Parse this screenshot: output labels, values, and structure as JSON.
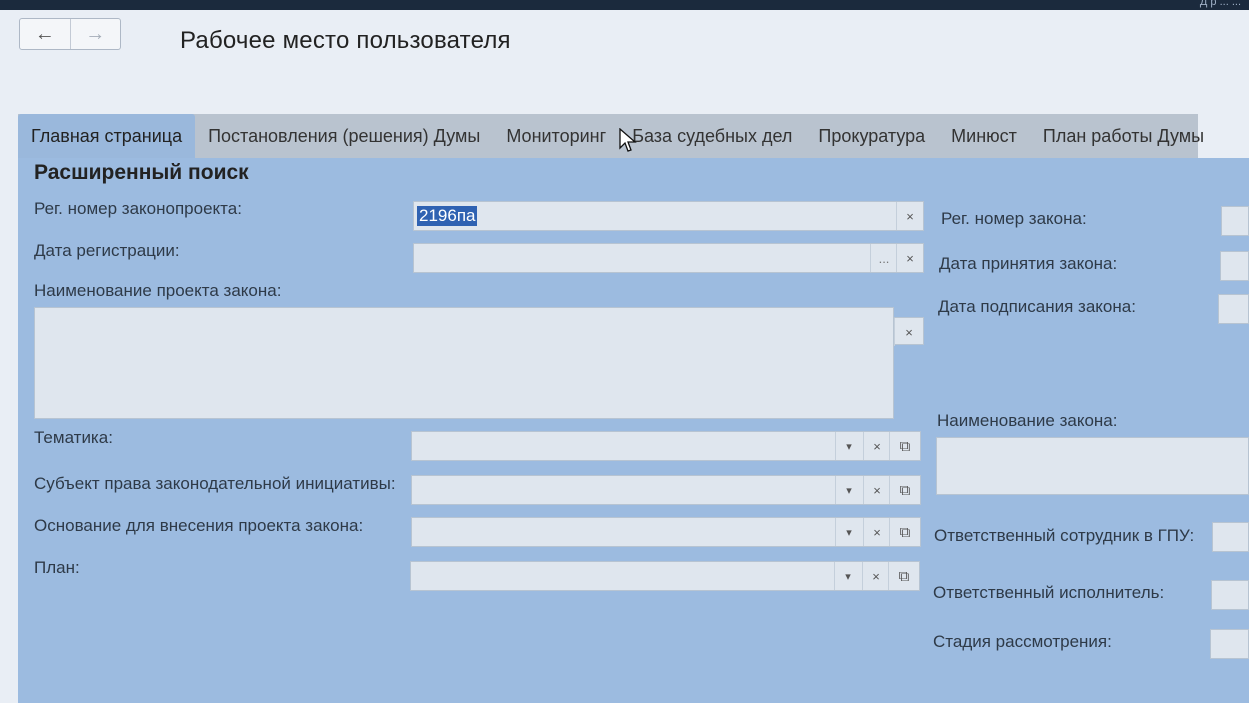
{
  "top_strip": {
    "partial_text": "Д            р          ...        ..."
  },
  "nav": {
    "back_glyph": "←",
    "forward_glyph": "→"
  },
  "header": {
    "title": "Рабочее место пользователя"
  },
  "tabs": [
    {
      "label": "Главная страница",
      "active": true
    },
    {
      "label": "Постановления (решения) Думы",
      "active": false
    },
    {
      "label": "Мониторинг",
      "active": false
    },
    {
      "label": "База судебных дел",
      "active": false
    },
    {
      "label": "Прокуратура",
      "active": false
    },
    {
      "label": "Минюст",
      "active": false
    },
    {
      "label": "План работы Думы",
      "active": false
    }
  ],
  "search": {
    "section_title": "Расширенный поиск",
    "reg_number_label": "Рег. номер законопроекта:",
    "reg_number_value": "2196па",
    "reg_date_label": "Дата регистрации:",
    "reg_date_value": "",
    "bill_name_label": "Наименование проекта закона:",
    "bill_name_value": "",
    "topic_label": "Тематика:",
    "initiative_subject_label": "Субъект права законодательной инициативы:",
    "submission_basis_label": "Основание для внесения проекта закона:",
    "plan_label": "План:",
    "law_reg_number_label": "Рег. номер закона:",
    "law_adoption_date_label": "Дата принятия закона:",
    "law_signing_date_label": "Дата подписания закона:",
    "law_name_label": "Наименование закона:",
    "gpu_employee_label": "Ответственный сотрудник в ГПУ:",
    "executor_label": "Ответственный исполнитель:",
    "stage_label": "Стадия рассмотрения:"
  },
  "icons": {
    "clear": "×",
    "dots": "...",
    "dropdown": "▾",
    "copy": "⧉"
  },
  "colors": {
    "panel": "#9cbbe0",
    "active_tab": "#9ab8dc",
    "tab_strip": "#b9c3cf",
    "selection": "#2f62b2"
  }
}
